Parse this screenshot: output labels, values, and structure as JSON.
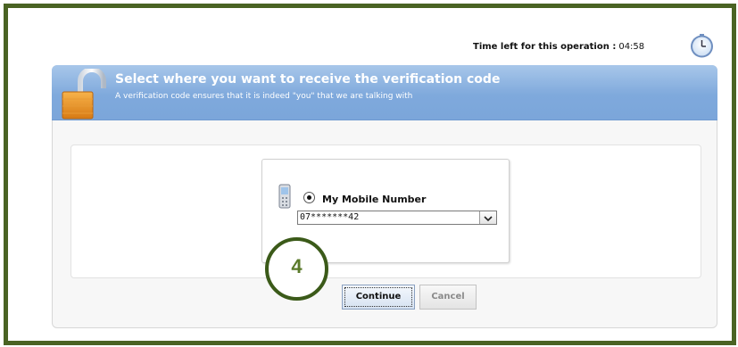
{
  "timer": {
    "label": "Time left for this operation :",
    "value": "04:58"
  },
  "header": {
    "title": "Select where you want to receive the verification code",
    "subtitle": "A verification code ensures that it is indeed \"you\" that we are talking with"
  },
  "option": {
    "label": "My Mobile Number",
    "selected": true,
    "number_value": "07*******42"
  },
  "annotation": {
    "step_number": "4"
  },
  "buttons": {
    "continue_label": "Continue",
    "cancel_label": "Cancel"
  },
  "icons": {
    "clock": "clock-icon",
    "lock": "unlocked-padlock-icon",
    "phone": "mobile-phone-icon",
    "dropdown": "chevron-down-icon"
  },
  "colors": {
    "frame_border": "#4a6323",
    "header_blue": "#7fa9dc",
    "step_circle": "#3b5a19"
  }
}
